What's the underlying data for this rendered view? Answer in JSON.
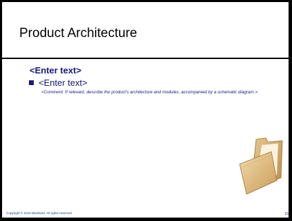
{
  "slide": {
    "title": "Product Architecture",
    "heading": "<Enter text>",
    "bullet": "<Enter text>",
    "comment": "<Comment: If relevant, describe the product's architecture and modules, accompanied by a schematic diagram.>",
    "footer_copyright": "Copyright © 2010 Blackbird. All rights reserved.",
    "page_number": "15",
    "image_icon": "folder-icon"
  },
  "colors": {
    "text_accent": "#16167a",
    "background": "#ffffff",
    "frame": "#000000",
    "footer": "#1a3a8a"
  }
}
